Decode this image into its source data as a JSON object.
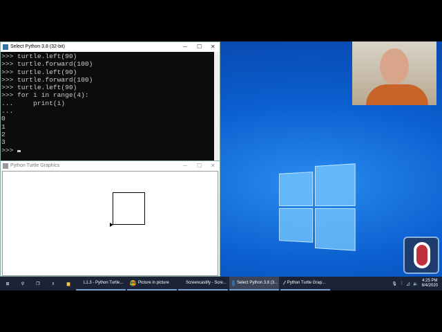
{
  "console": {
    "title": "Select Python 3.8 (32-bit)",
    "lines": [
      ">>> turtle.left(90)",
      ">>> turtle.forward(100)",
      ">>> turtle.left(90)",
      ">>> turtle.forward(100)",
      ">>> turtle.left(90)",
      ">>> for i in range(4):",
      "...     print(i)",
      "...",
      "0",
      "1",
      "2",
      "3",
      ">>> "
    ]
  },
  "turtle": {
    "title": "Python Turtle Graphics"
  },
  "taskbar": {
    "tasks": [
      {
        "label": "L1.3 - Python Turtle..."
      },
      {
        "label": "Picture in picture"
      },
      {
        "label": "Screencastify - Scre..."
      },
      {
        "label": "Select Python 3.8 (3..."
      },
      {
        "label": "Python Turtle Grap..."
      }
    ],
    "time": "4:25 PM",
    "date": "8/4/2020"
  },
  "colors": {
    "desktop": "#0b5fd0",
    "taskbar": "#1b2436",
    "console_bg": "#0c0c0c"
  }
}
